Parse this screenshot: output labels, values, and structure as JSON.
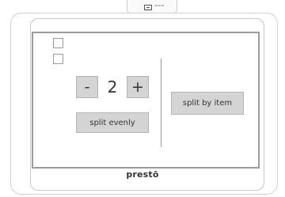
{
  "device": {
    "top_tab_label": "===",
    "brand": "prestō"
  },
  "screen": {
    "counter_value": "2",
    "minus_label": "-",
    "plus_label": "+",
    "split_evenly_label": "split evenly",
    "split_by_item_label": "split by item"
  },
  "icons": [
    "camera-icon"
  ],
  "colors": {
    "button_bg": "#d4d4d4",
    "screen_border": "#9b9b9b"
  }
}
